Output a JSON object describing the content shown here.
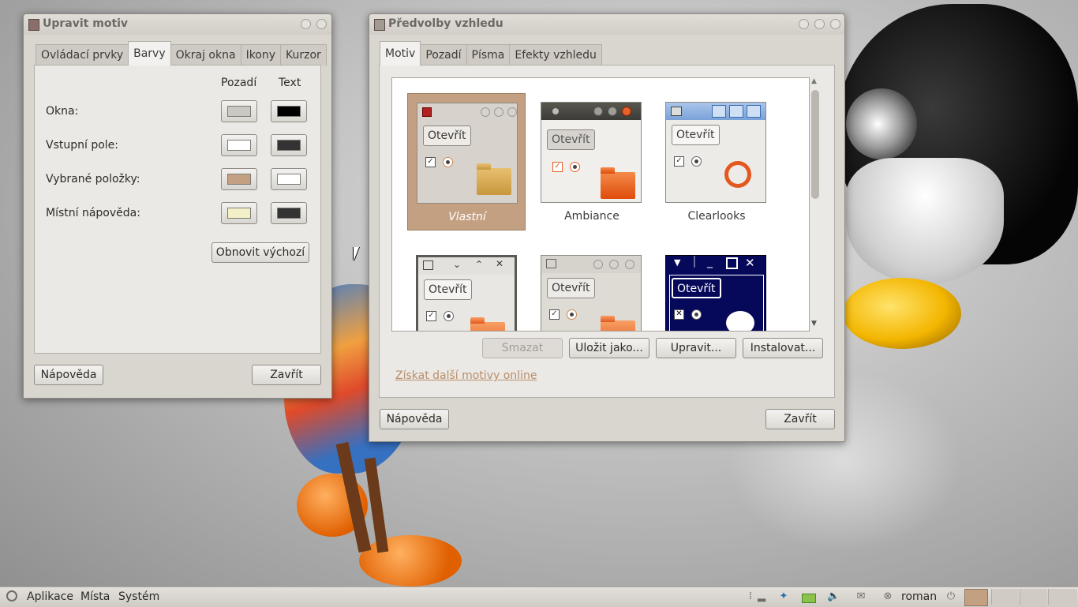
{
  "left_window": {
    "title": "Upravit motiv",
    "tabs": [
      "Ovládací prvky",
      "Barvy",
      "Okraj okna",
      "Ikony",
      "Kurzor"
    ],
    "active_tab": "Barvy",
    "col_background": "Pozadí",
    "col_text": "Text",
    "rows": [
      {
        "label": "Okna:",
        "bg": "#cbc7c1",
        "text": "#000000"
      },
      {
        "label": "Vstupní pole:",
        "bg": "#ffffff",
        "text": "#333333"
      },
      {
        "label": "Vybrané položky:",
        "bg": "#c3a082",
        "text": "#ffffff"
      },
      {
        "label": "Místní nápověda:",
        "bg": "#f3f0c8",
        "text": "#333333"
      }
    ],
    "reset_button": "Obnovit výchozí",
    "help_button": "Nápověda",
    "close_button": "Zavřít"
  },
  "right_window": {
    "title": "Předvolby vzhledu",
    "tabs": [
      "Motiv",
      "Pozadí",
      "Písma",
      "Efekty vzhledu"
    ],
    "active_tab": "Motiv",
    "themes": [
      {
        "name": "Vlastní",
        "button": "Otevřít"
      },
      {
        "name": "Ambiance",
        "button": "Otevřít"
      },
      {
        "name": "Clearlooks",
        "button": "Otevřít"
      },
      {
        "name": "",
        "button": "Otevřít"
      },
      {
        "name": "",
        "button": "Otevřít"
      },
      {
        "name": "",
        "button": "Otevřít"
      }
    ],
    "delete_button": "Smazat",
    "save_as_button": "Uložit jako...",
    "edit_button": "Upravit...",
    "install_button": "Instalovat...",
    "more_online_link": "Získat další motivy online",
    "help_button": "Nápověda",
    "close_button": "Zavřít"
  },
  "taskbar": {
    "apps_menu": "Aplikace",
    "places_menu": "Místa",
    "system_menu": "Systém",
    "username": "roman"
  },
  "colors": {
    "selected_theme": "#c3a082",
    "link": "#b98e6a"
  }
}
